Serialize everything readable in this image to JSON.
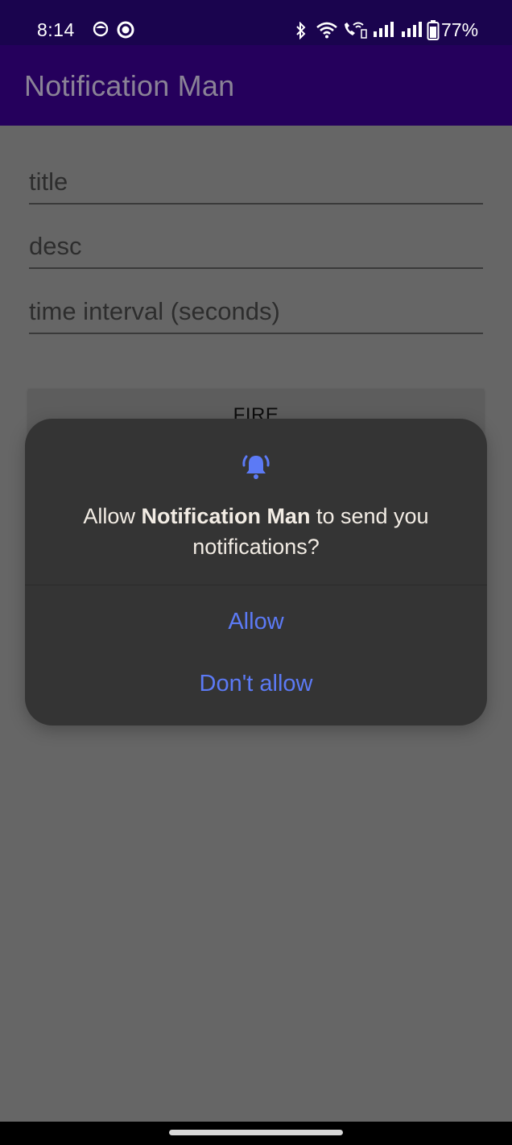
{
  "status_bar": {
    "time": "8:14",
    "battery_percent": "77%",
    "icons": [
      "face-icon",
      "circle-icon",
      "bluetooth-icon",
      "wifi-icon",
      "wifi-calling-icon",
      "signal-icon",
      "signal-icon",
      "battery-icon"
    ]
  },
  "app_bar": {
    "title": "Notification Man"
  },
  "form": {
    "title_placeholder": "title",
    "desc_placeholder": "desc",
    "interval_placeholder": "time interval (seconds)",
    "fire_label": "FIRE"
  },
  "dialog": {
    "icon": "notification-bell-icon",
    "message_prefix": "Allow ",
    "app_name": "Notification Man",
    "message_suffix": " to send you notifications?",
    "allow_label": "Allow",
    "deny_label": "Don't allow",
    "accent_color": "#5c7af5"
  }
}
